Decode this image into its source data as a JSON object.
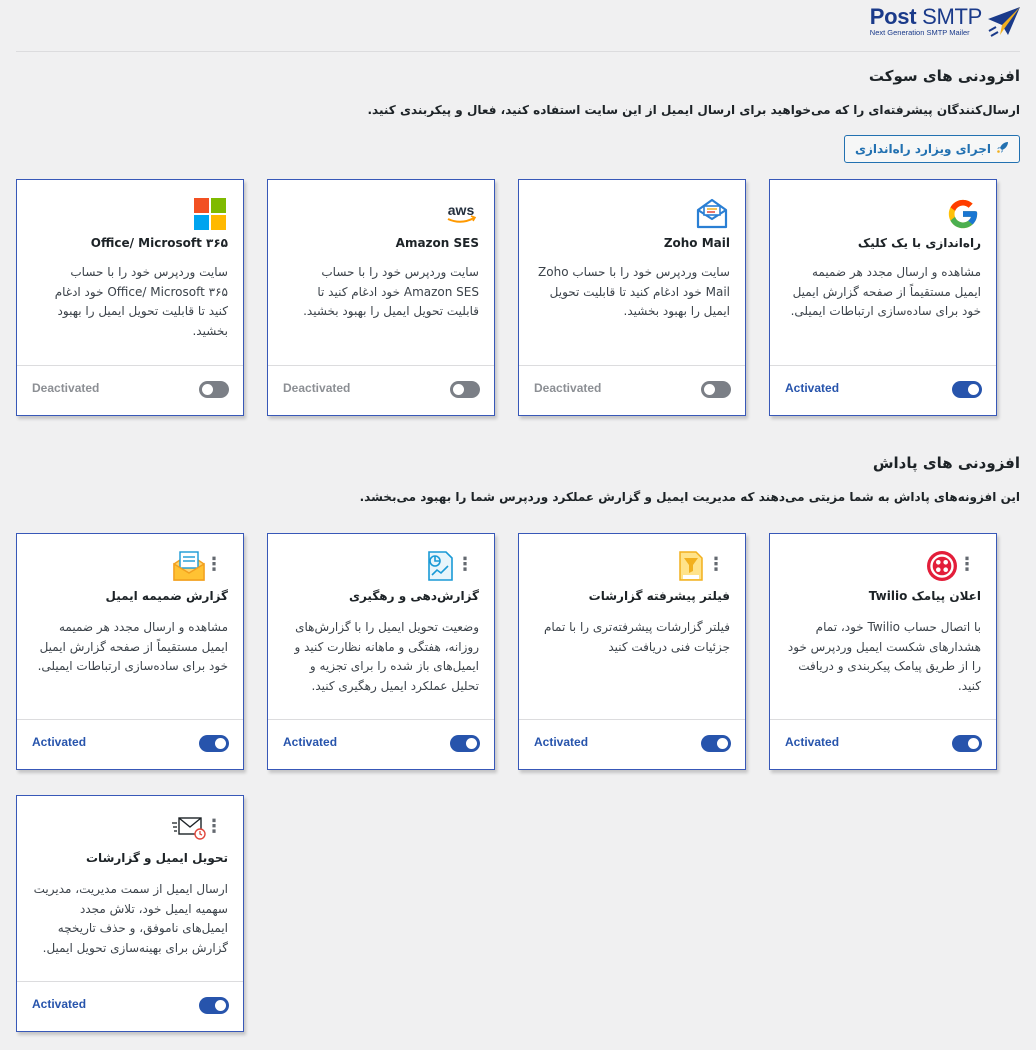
{
  "brand": {
    "name_bold": "Post",
    "name_rest": " SMTP",
    "tagline": "Next Generation SMTP Mailer"
  },
  "socket": {
    "title": "افزودنی های سوکت",
    "description": "ارسال‌کنندگان پیشرفته‌ای را که می‌خواهید برای ارسال ایمیل از این سایت استفاده کنید، فعال و پیکربندی کنید.",
    "wizard_button": "اجرای ویزارد راه‌اندازی",
    "cards": [
      {
        "icon": "google-icon",
        "title": "راه‌اندازی با یک کلیک",
        "description": "مشاهده و ارسال مجدد هر ضمیمه ایمیل مستقیماً از صفحه گزارش ایمیل خود برای ساده‌سازی ارتباطات ایمیلی.",
        "status": "Activated",
        "active": true
      },
      {
        "icon": "zoho-mail-icon",
        "title": "Zoho Mail",
        "description": "سایت وردپرس خود را با حساب Zoho Mail خود ادغام کنید تا قابلیت تحویل ایمیل را بهبود بخشید.",
        "status": "Deactivated",
        "active": false
      },
      {
        "icon": "aws-icon",
        "title": "Amazon SES",
        "description": "سایت وردپرس خود را با حساب Amazon SES خود ادغام کنید تا قابلیت تحویل ایمیل را بهبود بخشید.",
        "status": "Deactivated",
        "active": false
      },
      {
        "icon": "microsoft-icon",
        "title": "Office/ Microsoft ۳۶۵",
        "description": "سایت وردپرس خود را با حساب Office/ Microsoft ۳۶۵ خود ادغام کنید تا قابلیت تحویل ایمیل را بهبود بخشید.",
        "status": "Deactivated",
        "active": false
      }
    ]
  },
  "reward": {
    "title": "افزودنی های پاداش",
    "description": "این افزونه‌های پاداش به شما مزیتی می‌دهند که مدیریت ایمیل و گزارش عملکرد وردپرس شما را بهبود می‌بخشد.",
    "cards": [
      {
        "icon": "twilio-icon",
        "title": "اعلان پیامک Twilio",
        "description": "با اتصال حساب Twilio خود، تمام هشدارهای شکست ایمیل وردپرس خود را از طریق پیامک پیکربندی و دریافت کنید.",
        "status": "Activated",
        "active": true
      },
      {
        "icon": "log-filter-icon",
        "title": "فیلتر پیشرفته گزارشات",
        "description": "فیلتر گزارشات پیشرفته‌تری را با تمام جزئیات فنی دریافت کنید",
        "status": "Activated",
        "active": true
      },
      {
        "icon": "report-tracking-icon",
        "title": "گزارش‌دهی و رهگیری",
        "description": "وضعیت تحویل ایمیل را با گزارش‌های روزانه، هفتگی و ماهانه نظارت کنید و ایمیل‌های باز شده را برای تجزیه و تحلیل عملکرد ایمیل رهگیری کنید.",
        "status": "Activated",
        "active": true
      },
      {
        "icon": "email-attachment-icon",
        "title": "گزارش ضمیمه ایمیل",
        "description": "مشاهده و ارسال مجدد هر ضمیمه ایمیل مستقیماً از صفحه گزارش ایمیل خود برای ساده‌سازی ارتباطات ایمیلی.",
        "status": "Activated",
        "active": true
      },
      {
        "icon": "email-delivery-icon",
        "title": "تحویل ایمیل و گزارشات",
        "description": "ارسال ایمیل از سمت مدیریت، مدیریت سهمیه ایمیل خود، تلاش مجدد ایمیل‌های ناموفق، و حذف تاریخچه گزارش برای بهینه‌سازی تحویل ایمیل.",
        "status": "Activated",
        "active": true
      }
    ]
  },
  "colors": {
    "accent": "#2754ac",
    "border": "#3858b8",
    "inactive": "#7b7f86"
  }
}
